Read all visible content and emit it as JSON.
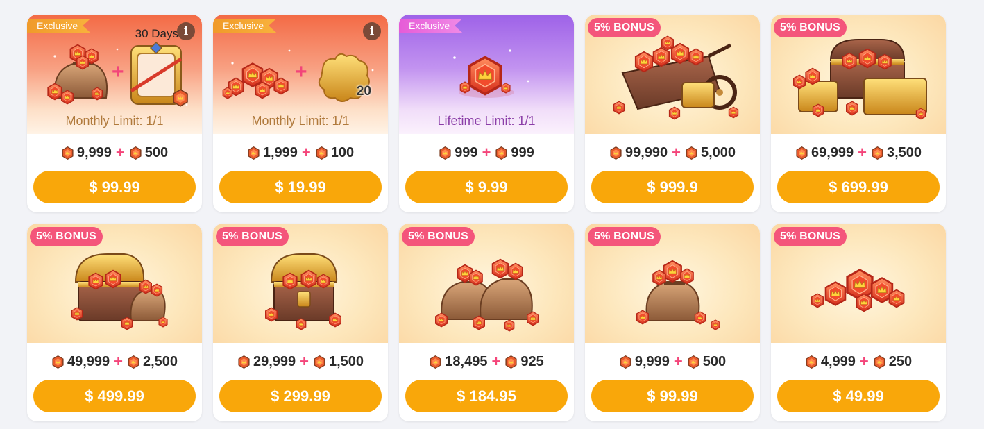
{
  "colors": {
    "accent": "#f9a70a",
    "bonus_tag": "#f4557b",
    "plus": "#f4457a",
    "exclusive_tag": "#f09a2a",
    "exclusive_tag_purple": "#e65bd7"
  },
  "cards": [
    {
      "tag": "Exclusive",
      "tag_style": "exclusive",
      "days": "30 Days",
      "has_info": true,
      "limit": "Monthly Limit: 1/1",
      "base": "9,999",
      "bonus": "500",
      "price": "$ 99.99",
      "art": "gem-bag-plus-avatar-frame-icon"
    },
    {
      "tag": "Exclusive",
      "tag_style": "exclusive",
      "days": "",
      "has_info": true,
      "limit": "Monthly Limit: 1/1",
      "base": "1,999",
      "bonus": "100",
      "price": "$ 19.99",
      "art": "gem-pile-plus-puzzle-piece-icon",
      "piece_count": "20"
    },
    {
      "tag": "Exclusive",
      "tag_style": "exclusive-purple",
      "days": "",
      "has_info": false,
      "limit": "Lifetime Limit: 1/1",
      "base": "999",
      "bonus": "999",
      "price": "$ 9.99",
      "art": "single-gem-icon"
    },
    {
      "tag": "5% BONUS",
      "tag_style": "bonus",
      "limit": "",
      "base": "99,990",
      "bonus": "5,000",
      "price": "$ 999.9",
      "art": "gem-cart-icon"
    },
    {
      "tag": "5% BONUS",
      "tag_style": "bonus",
      "limit": "",
      "base": "69,999",
      "bonus": "3,500",
      "price": "$ 699.99",
      "art": "treasure-chests-icon"
    },
    {
      "tag": "5% BONUS",
      "tag_style": "bonus",
      "limit": "",
      "base": "49,999",
      "bonus": "2,500",
      "price": "$ 499.99",
      "art": "treasure-chest-with-bag-icon"
    },
    {
      "tag": "5% BONUS",
      "tag_style": "bonus",
      "limit": "",
      "base": "29,999",
      "bonus": "1,500",
      "price": "$ 299.99",
      "art": "treasure-chest-icon"
    },
    {
      "tag": "5% BONUS",
      "tag_style": "bonus",
      "limit": "",
      "base": "18,495",
      "bonus": "925",
      "price": "$ 184.95",
      "art": "two-gem-bags-icon"
    },
    {
      "tag": "5% BONUS",
      "tag_style": "bonus",
      "limit": "",
      "base": "9,999",
      "bonus": "500",
      "price": "$ 99.99",
      "art": "gem-bag-icon"
    },
    {
      "tag": "5% BONUS",
      "tag_style": "bonus",
      "limit": "",
      "base": "4,999",
      "bonus": "250",
      "price": "$ 49.99",
      "art": "gem-pile-icon"
    }
  ]
}
